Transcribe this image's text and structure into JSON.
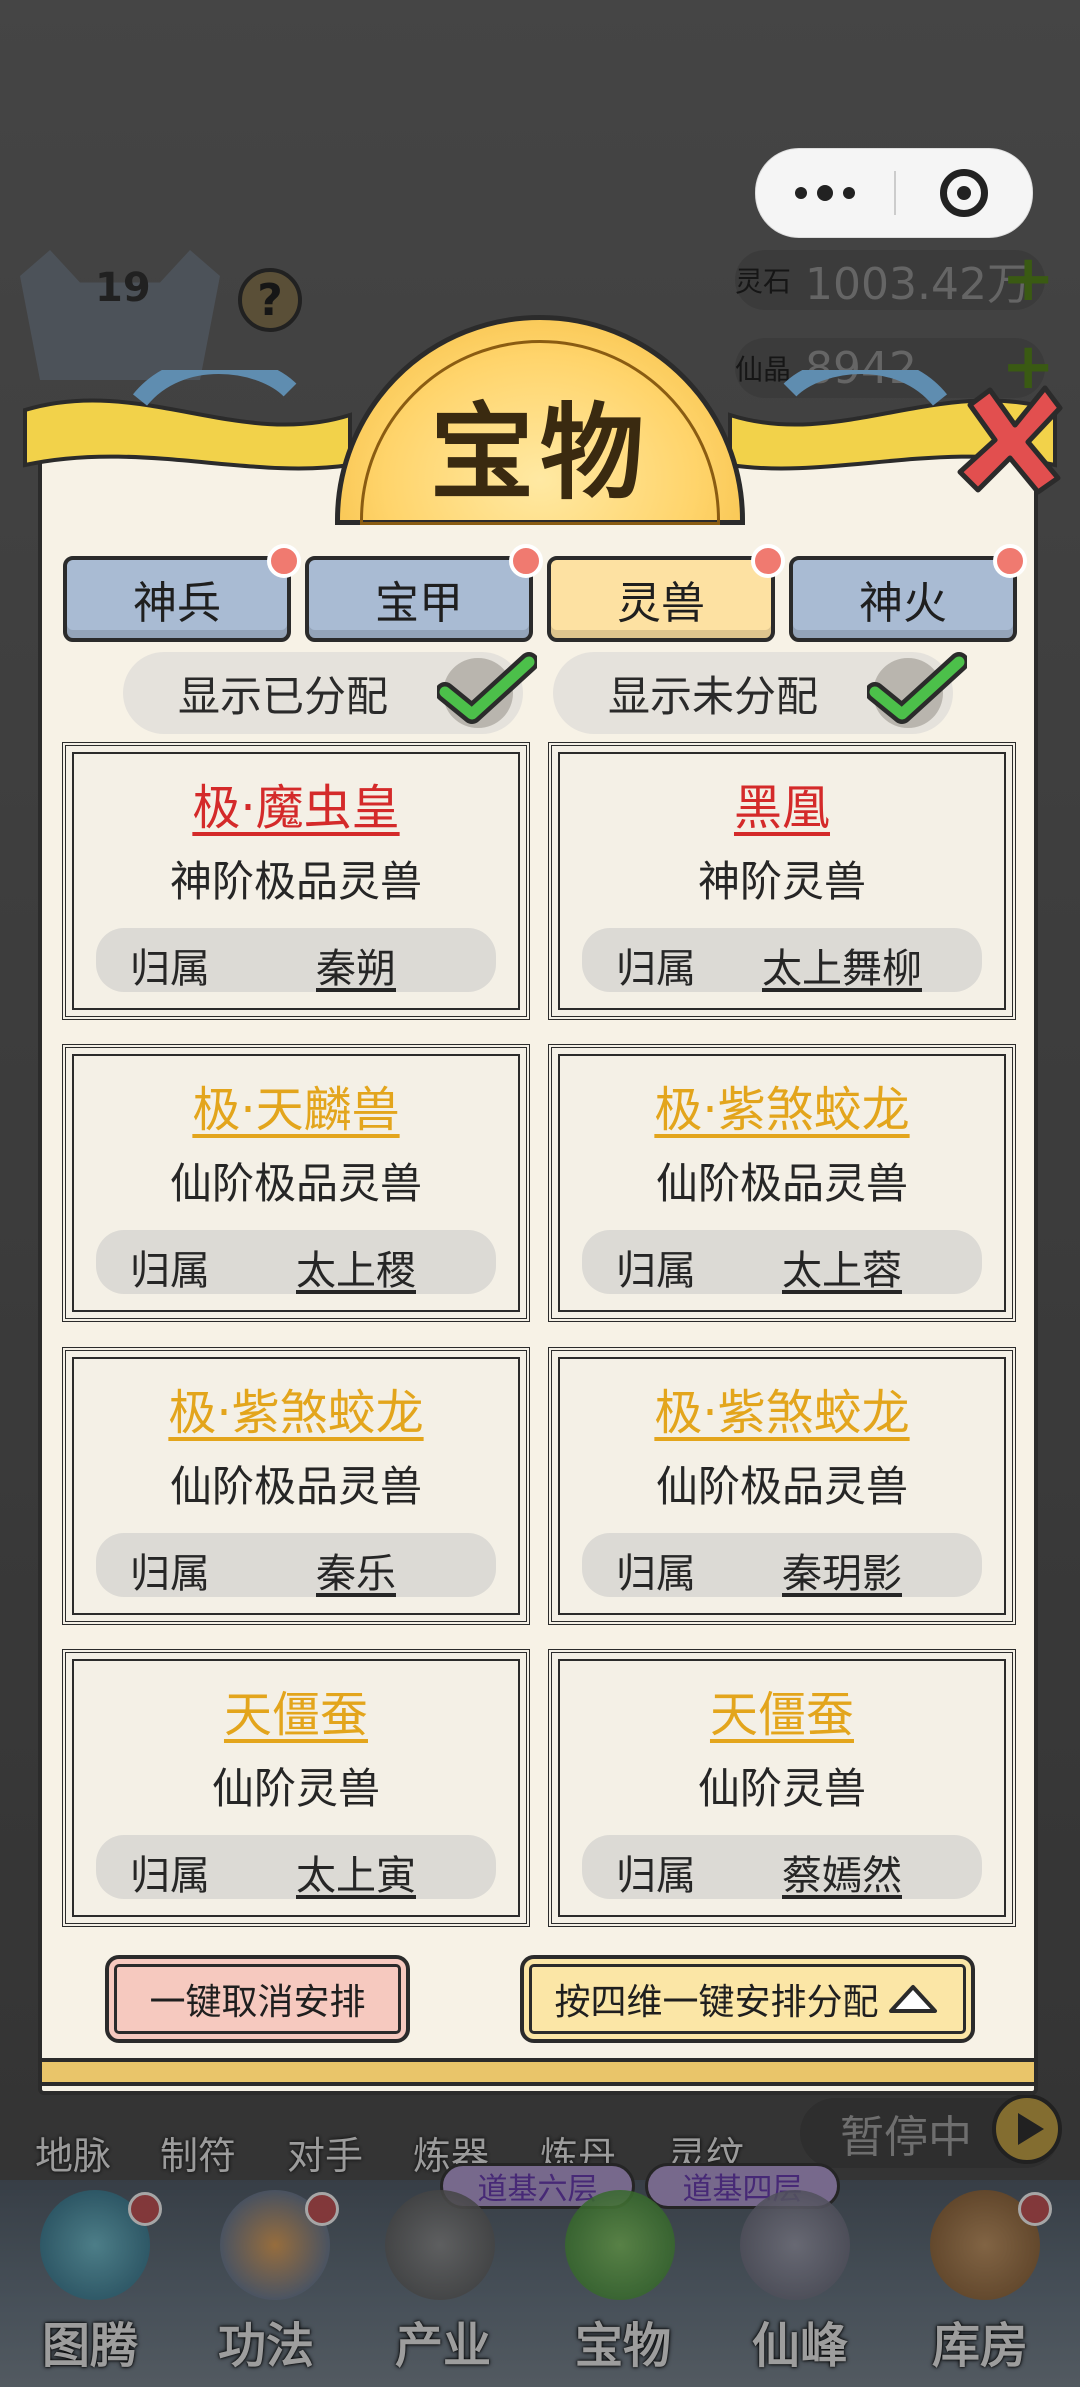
{
  "colors": {
    "accent_gold": "#e3a51c",
    "accent_red": "#d42a2a",
    "tab_blue": "#a9bbd3",
    "tab_active": "#fde1a2"
  },
  "hud": {
    "level": "19",
    "help": "?",
    "res1_label": "灵石",
    "res1_value": "1003.42万",
    "res2_label": "仙晶",
    "res2_value": "8942",
    "res_plus": "+"
  },
  "dialog": {
    "title": "宝物",
    "tabs": [
      {
        "label": "神兵",
        "active": false,
        "badge": true
      },
      {
        "label": "宝甲",
        "active": false,
        "badge": true
      },
      {
        "label": "灵兽",
        "active": true,
        "badge": true
      },
      {
        "label": "神火",
        "active": false,
        "badge": true
      }
    ],
    "toggles": [
      {
        "label": "显示已分配",
        "checked": true
      },
      {
        "label": "显示未分配",
        "checked": true
      }
    ],
    "owner_label": "归属",
    "cards": [
      {
        "name": "极·魔虫皇",
        "grade": "神阶极品灵兽",
        "owner": "秦朔",
        "color": "red"
      },
      {
        "name": "黑凰",
        "grade": "神阶灵兽",
        "owner": "太上舞柳",
        "color": "red"
      },
      {
        "name": "极·天麟兽",
        "grade": "仙阶极品灵兽",
        "owner": "太上稷",
        "color": "gold"
      },
      {
        "name": "极·紫煞蛟龙",
        "grade": "仙阶极品灵兽",
        "owner": "太上蓉",
        "color": "gold"
      },
      {
        "name": "极·紫煞蛟龙",
        "grade": "仙阶极品灵兽",
        "owner": "秦乐",
        "color": "gold"
      },
      {
        "name": "极·紫煞蛟龙",
        "grade": "仙阶极品灵兽",
        "owner": "秦玥影",
        "color": "gold"
      },
      {
        "name": "天僵蚕",
        "grade": "仙阶灵兽",
        "owner": "太上寅",
        "color": "gold"
      },
      {
        "name": "天僵蚕",
        "grade": "仙阶灵兽",
        "owner": "蔡嫣然",
        "color": "gold"
      }
    ],
    "btn_cancel": "一键取消安排",
    "btn_assign": "按四维一键安排分配"
  },
  "game": {
    "sub_nav": [
      "地脉",
      "制符",
      "对手",
      "炼器",
      "炼丹",
      "灵纹"
    ],
    "pause_label": "暂停中",
    "floor_tags": [
      "道基六层",
      "道基四层"
    ],
    "bottom_nav": [
      "图腾",
      "功法",
      "产业",
      "宝物",
      "仙峰",
      "库房"
    ]
  }
}
